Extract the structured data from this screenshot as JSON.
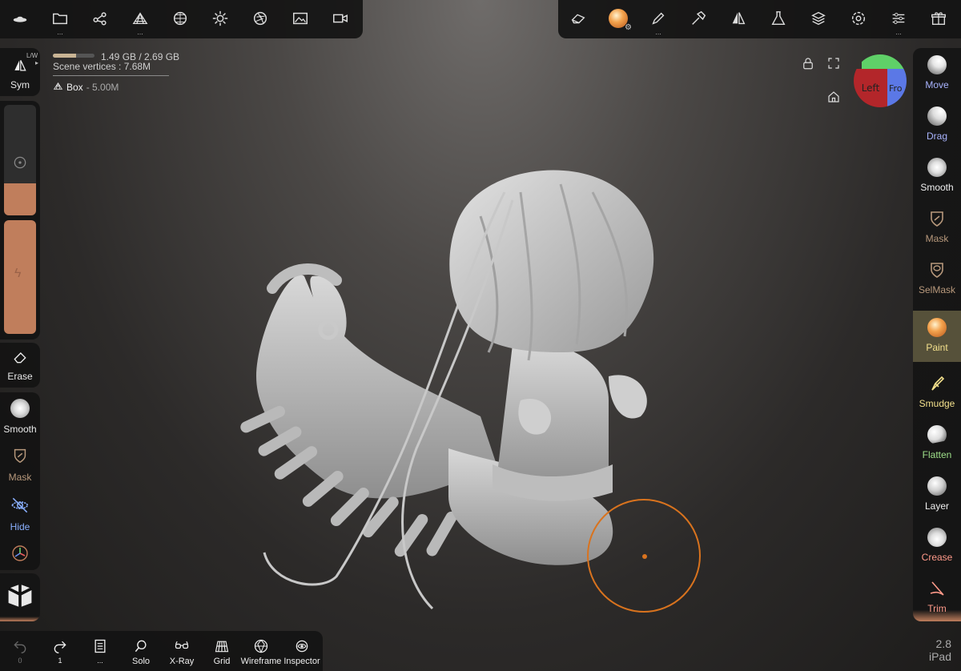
{
  "top_left_toolbar": {
    "items": [
      {
        "name": "nomad-logo-icon",
        "dots": ""
      },
      {
        "name": "folder-icon",
        "dots": "..."
      },
      {
        "name": "scene-graph-icon",
        "dots": ""
      },
      {
        "name": "topology-icon",
        "dots": "..."
      },
      {
        "name": "material-sphere-icon",
        "dots": ""
      },
      {
        "name": "light-icon",
        "dots": ""
      },
      {
        "name": "camera-aperture-icon",
        "dots": ""
      },
      {
        "name": "image-icon",
        "dots": ""
      },
      {
        "name": "video-camera-icon",
        "dots": ""
      }
    ]
  },
  "top_right_toolbar": {
    "items": [
      {
        "name": "eraser-box-icon",
        "dots": ""
      },
      {
        "name": "paint-material-icon",
        "dots": ""
      },
      {
        "name": "brush-icon",
        "dots": "..."
      },
      {
        "name": "hammer-icon",
        "dots": ""
      },
      {
        "name": "symmetry-icon",
        "dots": ""
      },
      {
        "name": "flask-icon",
        "dots": ""
      },
      {
        "name": "layers-icon",
        "dots": ""
      },
      {
        "name": "settings-gear-icon",
        "dots": ""
      },
      {
        "name": "sliders-icon",
        "dots": "..."
      },
      {
        "name": "gift-icon",
        "dots": ""
      }
    ]
  },
  "stats": {
    "memory": "1.49 GB / 2.69 GB",
    "memory_fraction": 0.55,
    "scene_vertices": "Scene vertices : 7.68M",
    "object": "Box",
    "object_vertices": "- 5.00M"
  },
  "left_panel": {
    "sym_label": "Sym",
    "lw_label": "L/W",
    "erase_label": "Erase",
    "smooth_label": "Smooth",
    "mask_label": "Mask",
    "hide_label": "Hide",
    "accent": "#c07e5c"
  },
  "right_tools": [
    {
      "label": "Move",
      "color": "#a9b4ff",
      "icon": "sphere-move-icon"
    },
    {
      "label": "Drag",
      "color": "#a9b4ff",
      "icon": "sphere-drag-icon"
    },
    {
      "label": "Smooth",
      "color": "#eeeeee",
      "icon": "smooth-icon"
    },
    {
      "label": "Mask",
      "color": "#b8997c",
      "icon": "mask-icon"
    },
    {
      "label": "SelMask",
      "color": "#b8997c",
      "icon": "selmask-icon"
    },
    {
      "label": "Paint",
      "color": "#f3e08c",
      "icon": "paint-icon",
      "active": true
    },
    {
      "label": "Smudge",
      "color": "#f3e08c",
      "icon": "smudge-icon"
    },
    {
      "label": "Flatten",
      "color": "#9fe08a",
      "icon": "flatten-icon"
    },
    {
      "label": "Layer",
      "color": "#eeeeee",
      "icon": "layer-icon"
    },
    {
      "label": "Crease",
      "color": "#ff9a8a",
      "icon": "crease-icon"
    },
    {
      "label": "Trim",
      "color": "#ff9a8a",
      "icon": "trim-icon"
    }
  ],
  "gizmo": {
    "left": "Left",
    "front": "Fro"
  },
  "bottom_toolbar": [
    {
      "label": "0",
      "name": "undo-button",
      "icon": "undo-icon"
    },
    {
      "label": "1",
      "name": "redo-button",
      "icon": "redo-icon"
    },
    {
      "label": "...",
      "name": "notes-button",
      "icon": "notes-icon"
    },
    {
      "label": "Solo",
      "name": "solo-button",
      "icon": "search-icon"
    },
    {
      "label": "X-Ray",
      "name": "xray-button",
      "icon": "glasses-icon"
    },
    {
      "label": "Grid",
      "name": "grid-button",
      "icon": "grid-icon"
    },
    {
      "label": "Wireframe",
      "name": "wireframe-button",
      "icon": "wireframe-icon"
    },
    {
      "label": "Inspector",
      "name": "inspector-button",
      "icon": "eye-icon"
    }
  ],
  "version": {
    "number": "2.8",
    "device": "iPad"
  },
  "colors": {
    "brush_ring": "#d9731e",
    "active_tool_bg": "#56513a"
  }
}
